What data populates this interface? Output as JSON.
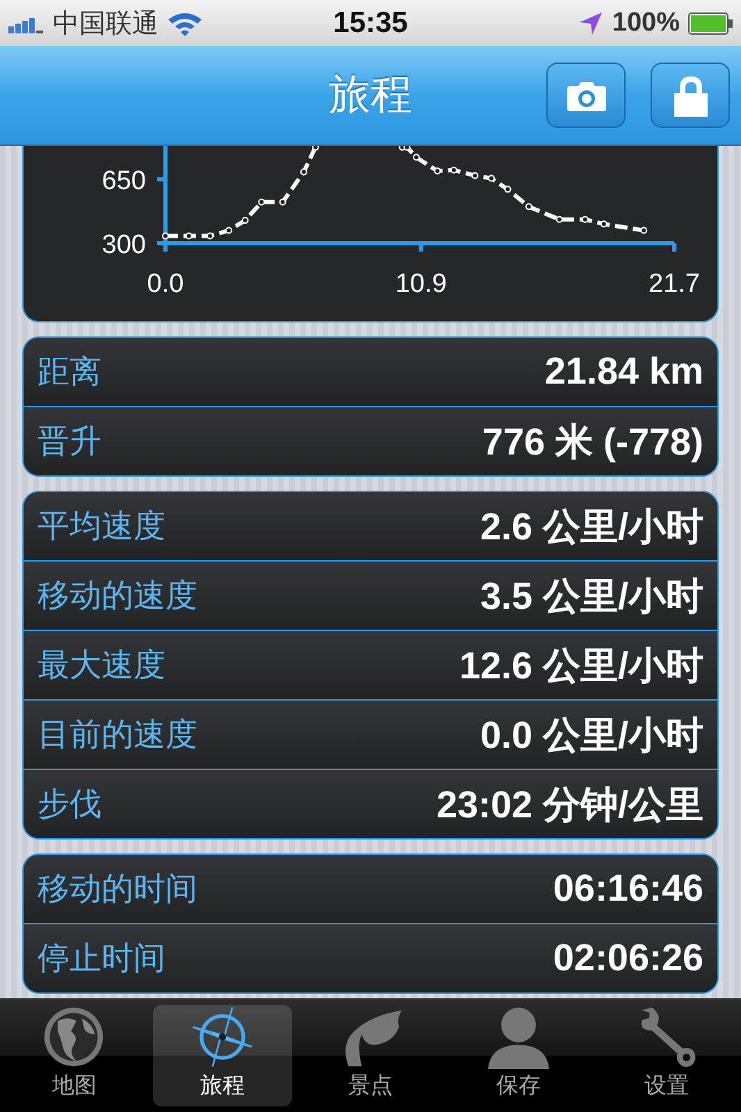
{
  "status_bar": {
    "carrier": "中国联通",
    "time": "15:35",
    "battery": "100%"
  },
  "nav_bar": {
    "title": "旅程"
  },
  "elevation_chart": {
    "chart_data": {
      "type": "line",
      "x": [
        0.0,
        1.0,
        1.9,
        2.7,
        3.4,
        4.1,
        5.0,
        5.9,
        6.4,
        8.2,
        10.1,
        10.3,
        10.7,
        11.6,
        12.3,
        13.2,
        13.9,
        14.6,
        15.5,
        16.8,
        17.9,
        18.7,
        20.4
      ],
      "series": [
        {
          "color": "#ffffff",
          "line_style": "dashed",
          "marker": "circle",
          "values": [
            340,
            340,
            340,
            370,
            425,
            525,
            525,
            690,
            825,
            null,
            825,
            825,
            770,
            695,
            700,
            670,
            655,
            595,
            500,
            430,
            430,
            405,
            370
          ]
        }
      ],
      "xticks": [
        {
          "value": 0,
          "label": "0.0"
        },
        {
          "value": 10.9,
          "label": "10.9"
        },
        {
          "value": 21.7,
          "label": "21.7"
        }
      ],
      "yticks": [
        300,
        650
      ],
      "xlim": [
        0,
        21.7
      ],
      "ylim": [
        300,
        832
      ]
    }
  },
  "groups": [
    {
      "rows": [
        {
          "label": "距离",
          "value": "21.84 km"
        },
        {
          "label": "晋升",
          "value": "776 米 (-778)"
        }
      ]
    },
    {
      "rows": [
        {
          "label": "平均速度",
          "value": "2.6 公里/小时"
        },
        {
          "label": "移动的速度",
          "value": "3.5 公里/小时"
        },
        {
          "label": "最大速度",
          "value": "12.6 公里/小时"
        },
        {
          "label": "目前的速度",
          "value": "0.0 公里/小时"
        },
        {
          "label": "步伐",
          "value": "23:02 分钟/公里"
        }
      ]
    },
    {
      "rows": [
        {
          "label": "移动的时间",
          "value": "06:16:46"
        },
        {
          "label": "停止时间",
          "value": "02:06:26"
        }
      ]
    }
  ],
  "tab_bar": [
    {
      "label": "地图",
      "kind": "globe",
      "selected": false
    },
    {
      "label": "旅程",
      "kind": "compass",
      "selected": true
    },
    {
      "label": "景点",
      "kind": "leaf",
      "selected": false
    },
    {
      "label": "保存",
      "kind": "person",
      "selected": false
    },
    {
      "label": "设置",
      "kind": "wrench",
      "selected": false
    }
  ]
}
